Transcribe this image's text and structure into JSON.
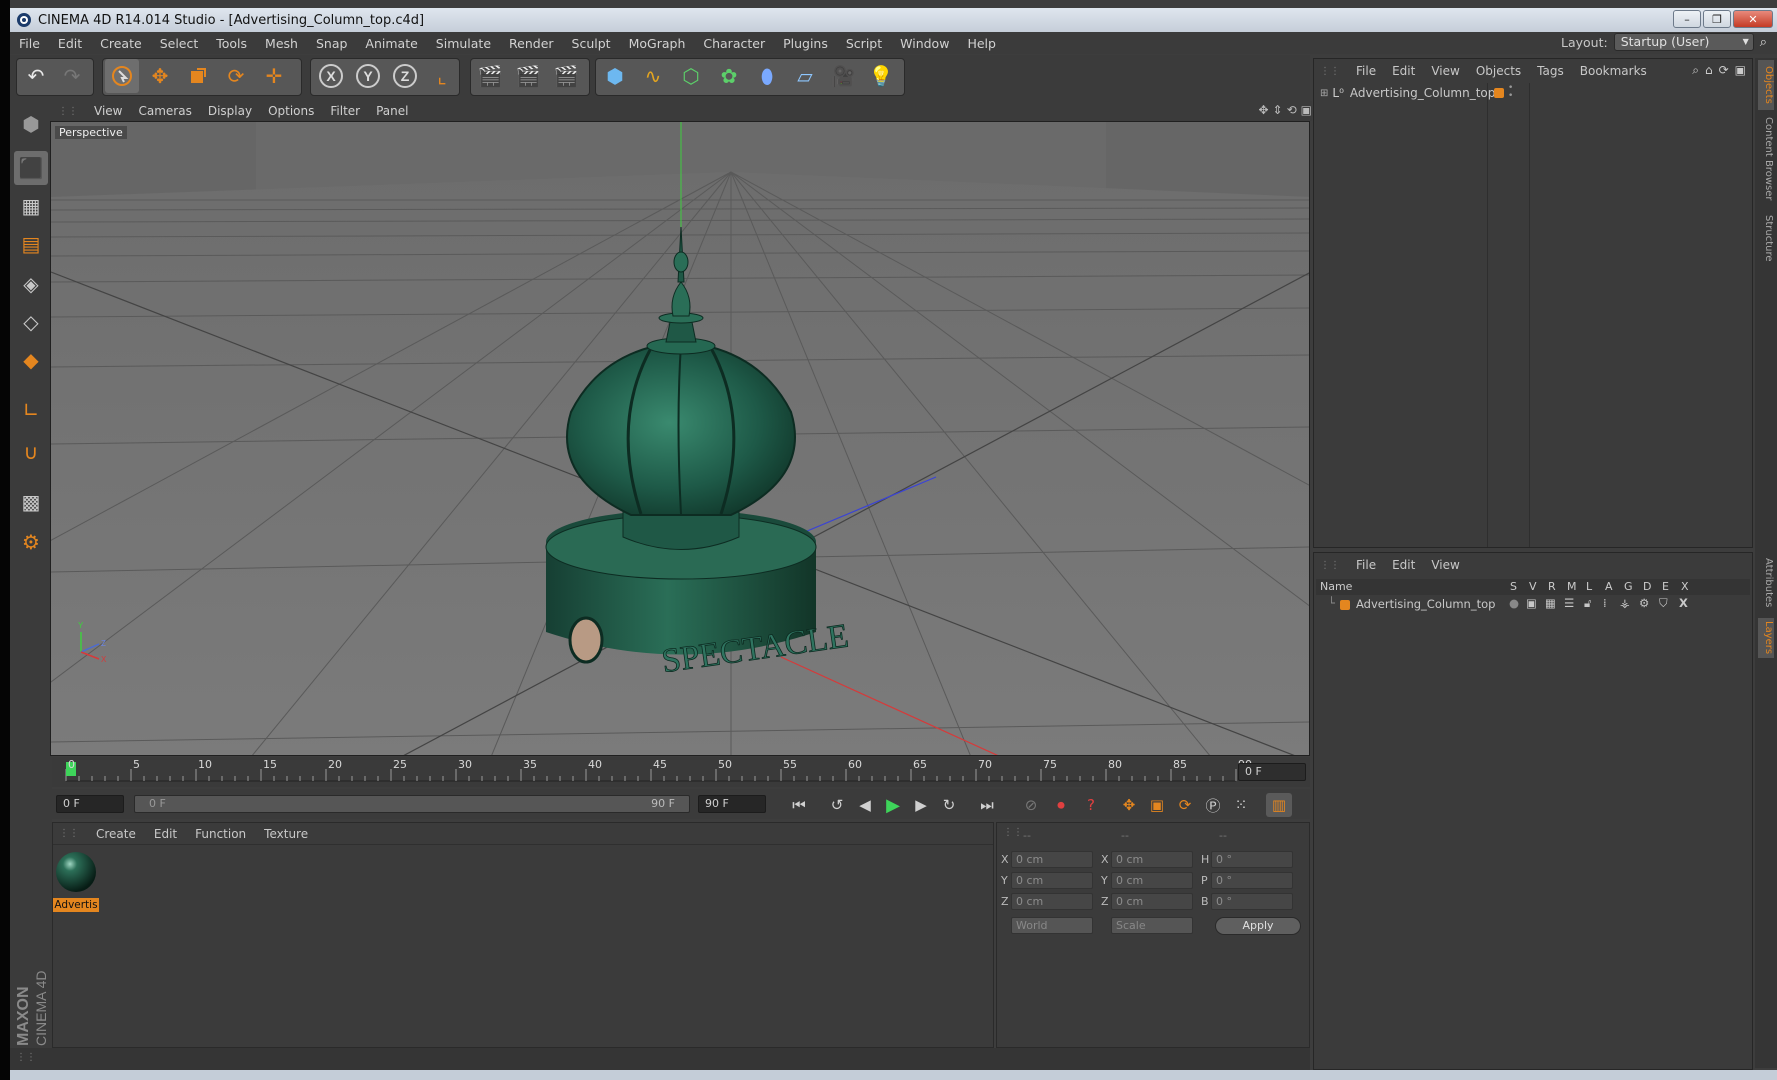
{
  "window": {
    "title": "CINEMA 4D R14.014 Studio - [Advertising_Column_top.c4d]",
    "buttons": [
      "–",
      "❐",
      "✕"
    ]
  },
  "menubar": {
    "items": [
      "File",
      "Edit",
      "Create",
      "Select",
      "Tools",
      "Mesh",
      "Snap",
      "Animate",
      "Simulate",
      "Render",
      "Sculpt",
      "MoGraph",
      "Character",
      "Plugins",
      "Script",
      "Window",
      "Help"
    ],
    "layout_label": "Layout:",
    "layout_value": "Startup (User)"
  },
  "viewport": {
    "menu": [
      "View",
      "Cameras",
      "Display",
      "Options",
      "Filter",
      "Panel"
    ],
    "label": "Perspective",
    "model_text": "SPECTACLE"
  },
  "timeline": {
    "ticks": [
      "0",
      "5",
      "10",
      "15",
      "20",
      "25",
      "30",
      "35",
      "40",
      "45",
      "50",
      "55",
      "60",
      "65",
      "70",
      "75",
      "80",
      "85",
      "90"
    ],
    "current_frame": "0 F",
    "start_field": "0 F",
    "range_start": "0 F",
    "range_end": "90 F",
    "end_field": "90 F"
  },
  "materials": {
    "menu": [
      "Create",
      "Edit",
      "Function",
      "Texture"
    ],
    "items": [
      {
        "label": "Advertis"
      }
    ]
  },
  "coordinates": {
    "headers": [
      "--",
      "--",
      "--"
    ],
    "rows": [
      {
        "l1": "X",
        "v1": "0 cm",
        "l2": "X",
        "v2": "0 cm",
        "l3": "H",
        "v3": "0 °"
      },
      {
        "l1": "Y",
        "v1": "0 cm",
        "l2": "Y",
        "v2": "0 cm",
        "l3": "P",
        "v3": "0 °"
      },
      {
        "l1": "Z",
        "v1": "0 cm",
        "l2": "Z",
        "v2": "0 cm",
        "l3": "B",
        "v3": "0 °"
      }
    ],
    "world_select": "World",
    "scale_select": "Scale",
    "apply_label": "Apply"
  },
  "objects_panel": {
    "menu": [
      "File",
      "Edit",
      "View",
      "Objects",
      "Tags",
      "Bookmarks"
    ],
    "items": [
      {
        "name": "Advertising_Column_top"
      }
    ]
  },
  "layers_panel": {
    "menu": [
      "File",
      "Edit",
      "View"
    ],
    "columns": [
      "Name",
      "S",
      "V",
      "R",
      "M",
      "L",
      "A",
      "G",
      "D",
      "E",
      "X"
    ],
    "items": [
      {
        "name": "Advertising_Column_top"
      }
    ]
  },
  "right_tabs": [
    "Objects",
    "Content Browser",
    "Structure",
    "Attributes",
    "Layers"
  ],
  "branding": {
    "maxon": "MAXON",
    "product": "CINEMA 4D"
  },
  "colors": {
    "accent_orange": "#e4861f",
    "model_green": "#1e5a48",
    "play_green": "#3ed45a"
  }
}
